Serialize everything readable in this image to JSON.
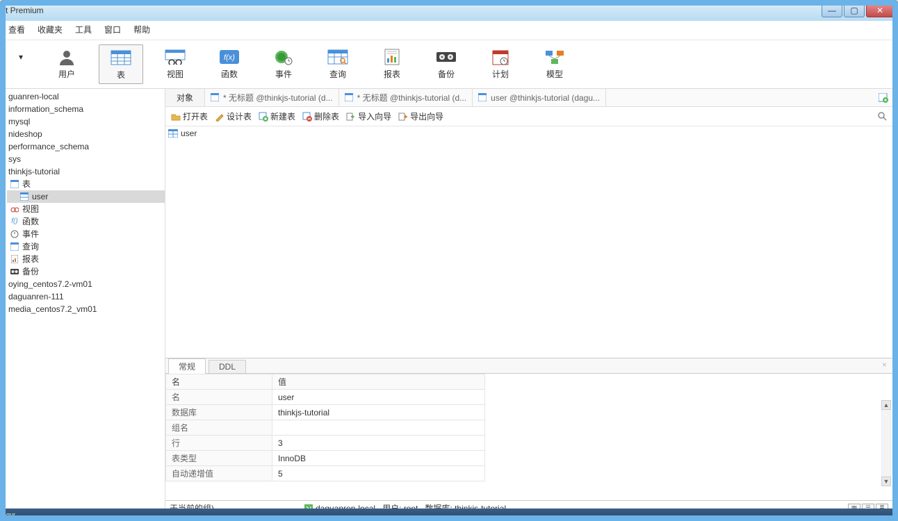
{
  "title": "t Premium",
  "menu": {
    "m1": "查看",
    "m2": "收藏夹",
    "m3": "工具",
    "m4": "窗口",
    "m5": "帮助"
  },
  "toolbar": {
    "user": "用户",
    "table": "表",
    "view": "视图",
    "function": "函数",
    "event": "事件",
    "query": "查询",
    "report": "报表",
    "backup": "备份",
    "plan": "计划",
    "model": "模型"
  },
  "tree": {
    "c1": "guanren-local",
    "c2": "information_schema",
    "c3": "mysql",
    "c4": "nideshop",
    "c5": "performance_schema",
    "c6": "sys",
    "c7": "thinkjs-tutorial",
    "tables": "表",
    "table_user": "user",
    "views": "视图",
    "functions": "函数",
    "events": "事件",
    "queries": "查询",
    "reports": "报表",
    "backups": "备份",
    "s1": "oying_centos7.2-vm01",
    "s2": "daguanren-111",
    "s3": "media_centos7.2_vm01"
  },
  "tabs": {
    "fixed": "对象",
    "t1": "* 无标题 @thinkjs-tutorial (d...",
    "t2": "* 无标题 @thinkjs-tutorial (d...",
    "t3": "user @thinkjs-tutorial (dagu..."
  },
  "actions": {
    "open": "打开表",
    "design": "设计表",
    "new": "新建表",
    "delete": "删除表",
    "import": "导入向导",
    "export": "导出向导"
  },
  "objects": {
    "user": "user"
  },
  "panel": {
    "tab_general": "常规",
    "tab_ddl": "DDL",
    "h_name": "名",
    "h_value": "值",
    "r_name": "名",
    "v_name": "user",
    "r_db": "数据库",
    "v_db": "thinkjs-tutorial",
    "r_group": "组名",
    "v_group": "",
    "r_rows": "行",
    "v_rows": "3",
    "r_type": "表类型",
    "v_type": "InnoDB",
    "r_ai": "自动递增值",
    "v_ai": "5"
  },
  "status": {
    "group": "于当前的组)",
    "conn": "daguanren-local",
    "user_lbl": "用户: root",
    "db_lbl": "数据库: thinkjs-tutorial"
  }
}
